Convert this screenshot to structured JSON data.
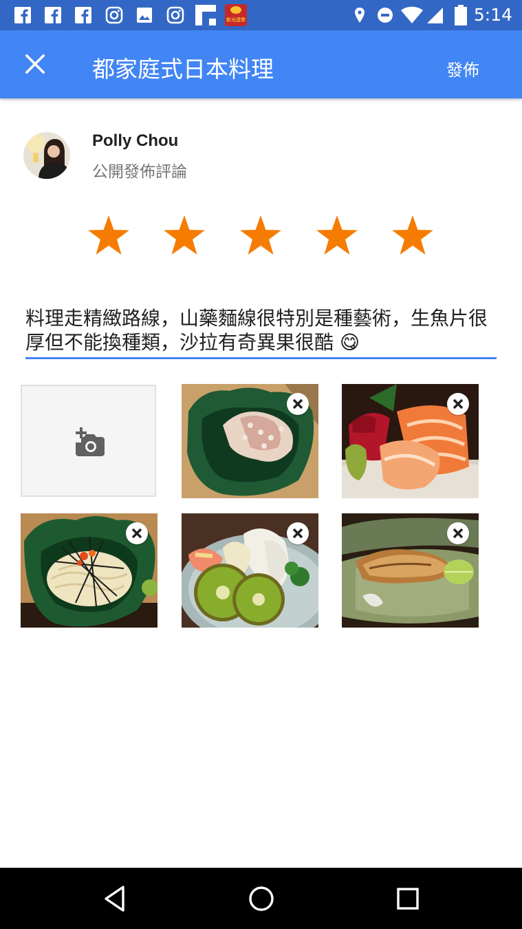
{
  "status_bar": {
    "time": "5:14",
    "icons": [
      "facebook-icon",
      "facebook-icon",
      "facebook-icon",
      "instagram-icon",
      "image-icon",
      "instagram-icon",
      "flipboard-icon",
      "app-badge-icon",
      "location-icon",
      "do-not-disturb-icon",
      "wifi-icon",
      "signal-icon",
      "battery-icon"
    ],
    "badge_text": "新光證券"
  },
  "app_bar": {
    "title": "都家庭式日本料理",
    "publish_label": "發佈",
    "close_icon": "close-icon"
  },
  "user": {
    "name": "Polly Chou",
    "subtitle": "公開發佈評論"
  },
  "rating": {
    "value": 5,
    "max": 5,
    "star_color": "#f57c00"
  },
  "review": {
    "text": "料理走精緻路線，山藥麵線很特別是種藝術，生魚片很厚但不能換種類，沙拉有奇異果很酷 😋"
  },
  "photos": {
    "add_icon": "add-photo-icon",
    "items": [
      {
        "subject": "octopus"
      },
      {
        "subject": "sashimi"
      },
      {
        "subject": "yam-noodles"
      },
      {
        "subject": "kiwi-salad"
      },
      {
        "subject": "grilled-fish"
      }
    ]
  },
  "nav_bar": {
    "icons": [
      "back-icon",
      "home-icon",
      "recents-icon"
    ]
  },
  "colors": {
    "status_bar": "#3367c5",
    "app_bar": "#4285f4",
    "accent": "#4285f4",
    "star": "#f57c00"
  }
}
